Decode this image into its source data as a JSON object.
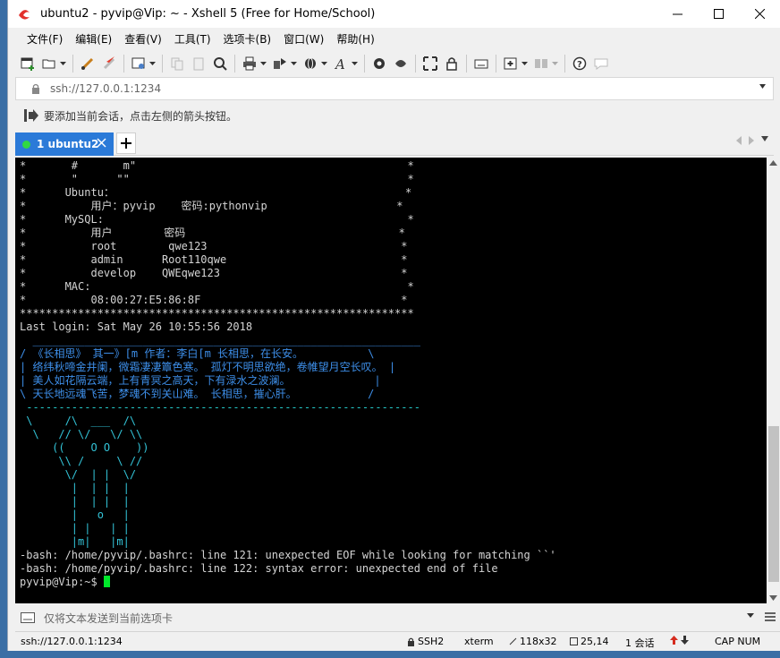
{
  "window": {
    "title": "ubuntu2 - pyvip@Vip: ~ - Xshell 5 (Free for Home/School)"
  },
  "menu": [
    {
      "label": "文件(F)"
    },
    {
      "label": "编辑(E)"
    },
    {
      "label": "查看(V)"
    },
    {
      "label": "工具(T)"
    },
    {
      "label": "选项卡(B)"
    },
    {
      "label": "窗口(W)"
    },
    {
      "label": "帮助(H)"
    }
  ],
  "address": {
    "value": "ssh://127.0.0.1:1234"
  },
  "hint": {
    "text": "要添加当前会话，点击左侧的箭头按钮。"
  },
  "tabs": [
    {
      "label": "1 ubuntu2",
      "active": true
    }
  ],
  "terminal": {
    "lines": [
      "*       #       m\"                                          *",
      "*       \"      \"\"                                           *",
      "*      Ubuntu：                                             *",
      "*          用户：pyvip    密码:pythonvip                    *",
      "*      MySQL:                                               *",
      "*          用户        密码                                 *",
      "*          root        qwe123                              *",
      "*          admin      Root110qwe                           *",
      "*          develop    QWEqwe123                            *",
      "*      MAC:                                                 *",
      "*          08:00:27:E5:86:8F                               *",
      "*************************************************************",
      "Last login: Sat May 26 10:55:56 2018",
      "  ____________________________________________________________",
      "/ 《长相思》 其一》[m 作者：李白[m 长相思，在长安。          \\",
      "| 络纬秋啼金井阑，微霜凄凄簟色寒。 孤灯不明思欲绝，卷帷望月空长叹。 |",
      "| 美人如花隔云端，上有青冥之高天，下有渌水之波澜。             |",
      "\\ 天长地远魂飞苦，梦魂不到关山难。 长相思，摧心肝。           /",
      " -------------------------------------------------------------",
      " \\     /\\  ___  /\\",
      "  \\   // \\/   \\/ \\\\",
      "     ((    O O    ))",
      "      \\\\ /     \\ //",
      "       \\/  | |  \\/",
      "        |  | |  |",
      "        |  | |  |",
      "        |   o   |",
      "        | |   | |",
      "        |m|   |m|",
      "-bash: /home/pyvip/.bashrc: line 121: unexpected EOF while looking for matching ``'",
      "-bash: /home/pyvip/.bashrc: line 122: syntax error: unexpected end of file",
      "pyvip@Vip:~$ "
    ]
  },
  "send_bar": {
    "placeholder": "仅将文本发送到当前选项卡"
  },
  "status": {
    "address": "ssh://127.0.0.1:1234",
    "protocol": "SSH2",
    "term": "xterm",
    "size": "118x32",
    "position": "25,14",
    "sessions": "1 会话",
    "caps": "CAP NUM"
  },
  "colors": {
    "tab_active": "#2b7ad8",
    "terminal_bg": "#000000",
    "cursor": "#00e82a"
  }
}
